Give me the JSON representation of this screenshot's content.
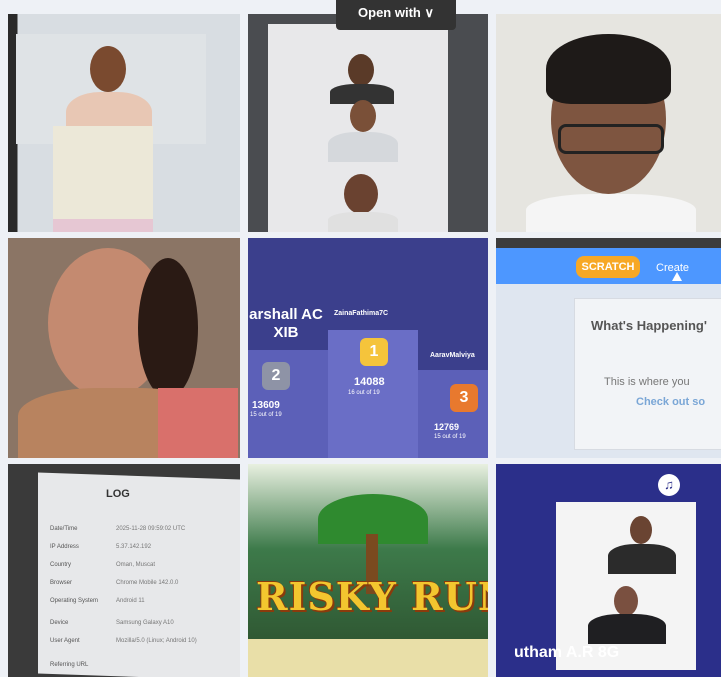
{
  "top_bar": {
    "open_with_label": "Open with ∨"
  },
  "leaderboard": {
    "first": {
      "name": "ZainaFathima7C",
      "rank": "1",
      "score": "14088",
      "detail": "16 out of 19"
    },
    "second": {
      "name": "arshall AC XIB",
      "rank": "2",
      "score": "13609",
      "detail": "15 out of 19"
    },
    "third": {
      "name": "AaravMalviya",
      "rank": "3",
      "score": "12769",
      "detail": "15 out of 19"
    }
  },
  "scratch": {
    "logo": "SCRATCH",
    "create_label": "Create",
    "whats_happening": "What's Happening'",
    "body_line": "This is where you",
    "link_line": "Check out so"
  },
  "log": {
    "title": "LOG",
    "rows": [
      {
        "label": "Date/Time",
        "value": "2025-11-28 09:59:02 UTC"
      },
      {
        "label": "IP Address",
        "value": "5.37.142.192"
      },
      {
        "label": "Country",
        "value": "Oman, Muscat"
      },
      {
        "label": "Browser",
        "value": "Chrome Mobile 142.0.0"
      },
      {
        "label": "Operating System",
        "value": "Android 11"
      },
      {
        "label": "Device",
        "value": "Samsung Galaxy A10"
      },
      {
        "label": "User Agent",
        "value": "Mozilla/5.0 (Linux; Android 10)"
      },
      {
        "label": "Referring URL",
        "value": ""
      }
    ]
  },
  "game": {
    "title": "RISKY RUN"
  },
  "participant": {
    "name": "utham A.R 8G"
  },
  "icons": [
    "music-icon",
    "mouse-cursor-icon"
  ]
}
